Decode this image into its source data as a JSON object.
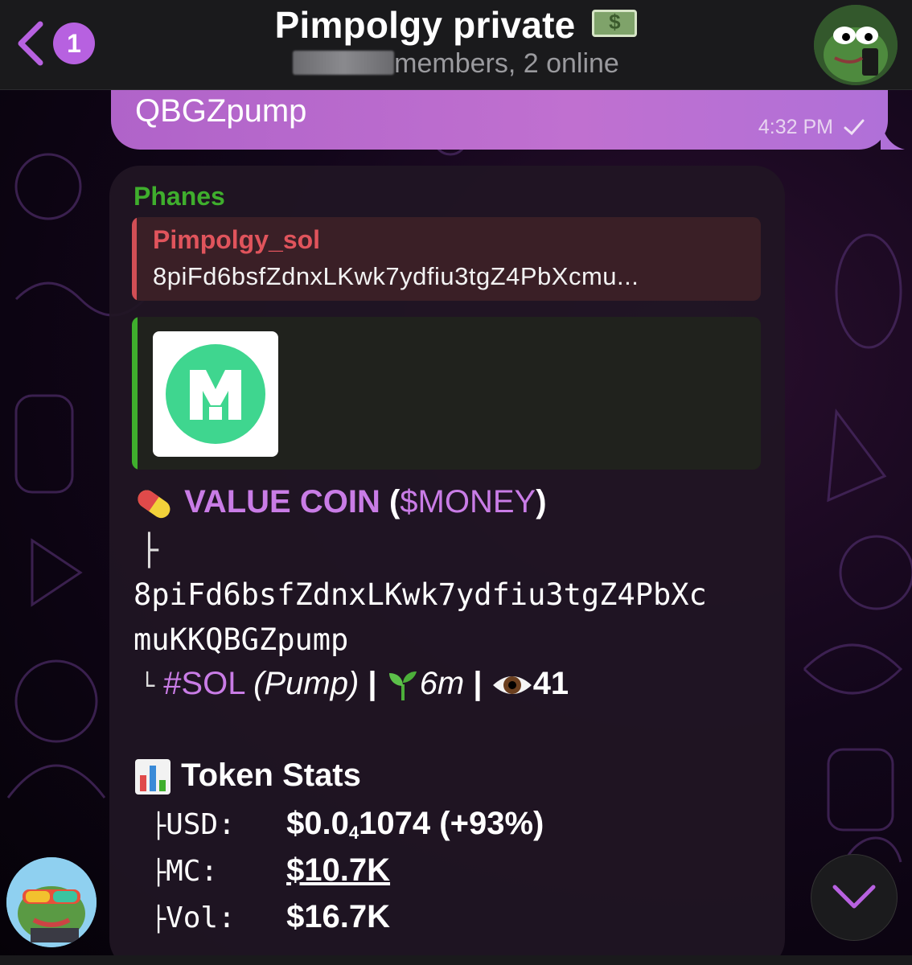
{
  "header": {
    "unread_count": "1",
    "title": "Pimpolgy private",
    "subtitle_suffix": "members, 2 online"
  },
  "outgoing": {
    "text": "QBGZpump",
    "time": "4:32 PM"
  },
  "incoming": {
    "sender": "Phanes",
    "reply": {
      "name": "Pimpolgy_sol",
      "text": "8piFd6bsfZdnxLKwk7ydfiu3tgZ4PbXcmu..."
    },
    "token": {
      "name": "VALUE COIN",
      "ticker_open": " (",
      "ticker": "$MONEY",
      "ticker_close": ")",
      "tree_branch": "├",
      "address_line1": "8piFd6bsfZdnxLKwk7ydfiu3tgZ4PbXc",
      "address_line2": "muKKQBGZpump",
      "tree_end": "└",
      "chain_tag": "#SOL",
      "platform": "(Pump)",
      "separator": " | ",
      "age": "6m",
      "views": "41"
    },
    "stats": {
      "heading": "Token Stats",
      "rows": [
        {
          "branch": "├",
          "label": "USD:",
          "value_main": "$0.0",
          "value_sub": "4",
          "value_rest": "1074 (+93%)"
        },
        {
          "branch": "├",
          "label": "MC:",
          "value_main": "$10.7K",
          "value_sub": "",
          "value_rest": ""
        },
        {
          "branch": "├",
          "label": "Vol:",
          "value_main": "$16.7K",
          "value_sub": "",
          "value_rest": ""
        }
      ]
    }
  },
  "icons": {
    "back": "chevron-left-icon",
    "money": "money-bag-emoji",
    "pill": "pill-emoji",
    "seedling": "seedling-emoji",
    "eye": "eye-emoji",
    "chart": "bar-chart-emoji",
    "scroll": "chevron-down-icon"
  },
  "colors": {
    "accent": "#b761e0",
    "sender": "#3fae2d",
    "reply_name": "#e0545c",
    "token_purple": "#c97ce6"
  }
}
